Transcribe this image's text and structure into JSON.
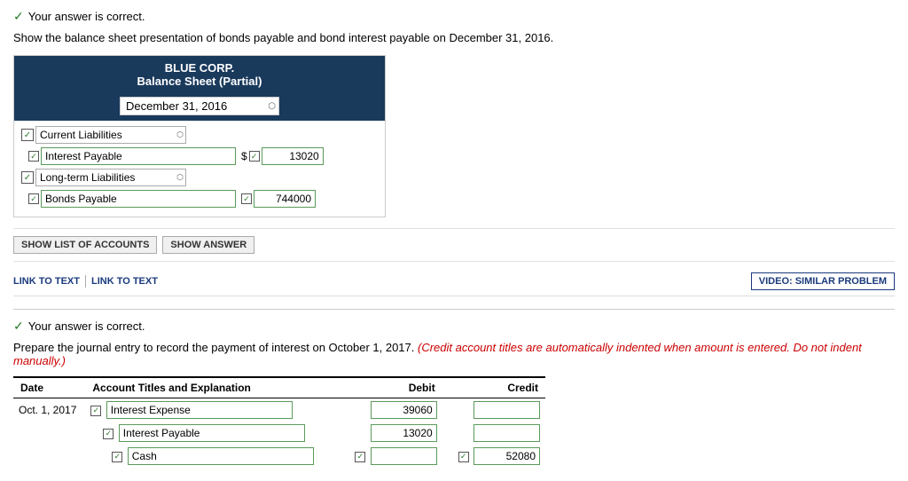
{
  "section1": {
    "correct_msg": "Your answer is correct.",
    "question": "Show the balance sheet presentation of bonds payable and bond interest payable on December 31, 2016.",
    "company_name": "BLUE CORP.",
    "sheet_title": "Balance Sheet (Partial)",
    "date_value": "December 31, 2016",
    "current_liabilities_label": "Current Liabilities",
    "interest_payable_label": "Interest Payable",
    "interest_payable_amount": "13020",
    "dollar_sign": "$",
    "long_term_liabilities_label": "Long-term Liabilities",
    "bonds_payable_label": "Bonds Payable",
    "bonds_payable_amount": "744000",
    "toolbar": {
      "show_list": "SHOW LIST OF ACCOUNTS",
      "show_answer": "SHOW ANSWER"
    },
    "links": {
      "link1": "LINK TO TEXT",
      "link2": "LINK TO TEXT",
      "video": "VIDEO: SIMILAR PROBLEM"
    }
  },
  "section2": {
    "correct_msg": "Your answer is correct.",
    "question_start": "Prepare the journal entry to record the payment of interest on October 1, 2017.",
    "question_italic": "(Credit account titles are automatically indented when amount is entered. Do not indent manually.)",
    "table": {
      "col_date": "Date",
      "col_account": "Account Titles and Explanation",
      "col_debit": "Debit",
      "col_credit": "Credit",
      "rows": [
        {
          "date": "Oct. 1, 2017",
          "account": "Interest Expense",
          "debit": "39060",
          "credit": ""
        },
        {
          "date": "",
          "account": "Interest Payable",
          "debit": "13020",
          "credit": ""
        },
        {
          "date": "",
          "account": "Cash",
          "debit": "",
          "credit": "52080"
        }
      ]
    }
  }
}
